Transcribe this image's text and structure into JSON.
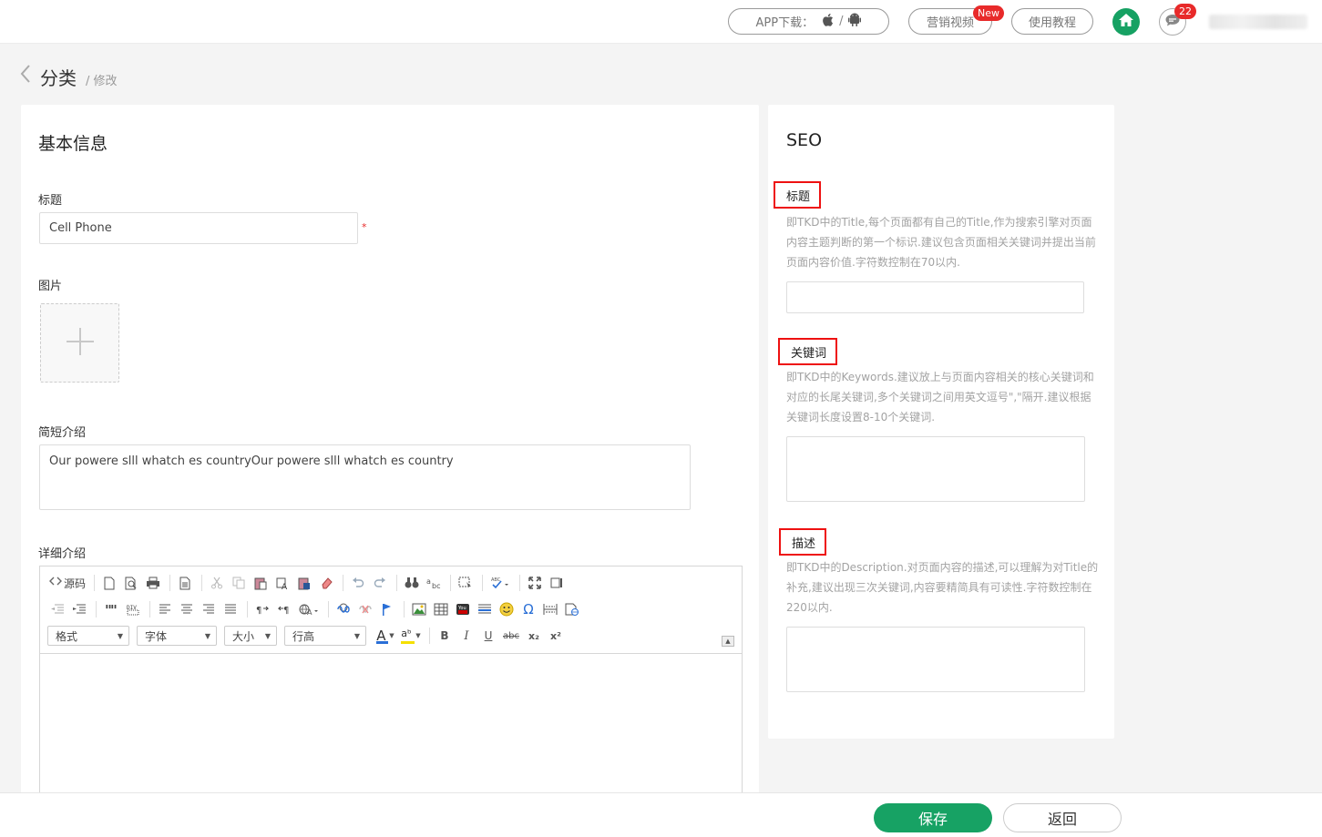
{
  "header": {
    "app_download_label": "APP下载：",
    "app_separator": "/",
    "marketing_video_label": "营销视频",
    "new_badge": "New",
    "tutorial_label": "使用教程",
    "message_count": "22"
  },
  "breadcrumb": {
    "title": "分类",
    "sub": "/ 修改"
  },
  "basic_info": {
    "section_title": "基本信息",
    "title_label": "标题",
    "title_value": "Cell Phone",
    "required_mark": "*",
    "image_label": "图片",
    "short_intro_label": "简短介绍",
    "short_intro_value": "Our powere slll whatch es countryOur powere slll whatch es country",
    "detail_label": "详细介绍"
  },
  "editor": {
    "source_label": "源码",
    "format_label": "格式",
    "font_label": "字体",
    "size_label": "大小",
    "line_height_label": "行高",
    "bold": "B",
    "italic": "I",
    "underline": "U",
    "strike": "abc",
    "subscript": "x₂",
    "superscript": "x²",
    "text_color": "A",
    "bg_color": "aᵇ",
    "omega": "Ω"
  },
  "seo": {
    "section_title": "SEO",
    "title_label": "标题",
    "title_help": "即TKD中的Title,每个页面都有自己的Title,作为搜索引擎对页面内容主题判断的第一个标识.建议包含页面相关关键词并提出当前页面内容价值.字符数控制在70以内.",
    "title_value": "",
    "keywords_label": "关键词",
    "keywords_help": "即TKD中的Keywords.建议放上与页面内容相关的核心关键词和对应的长尾关键词,多个关键词之间用英文逗号\",\"隔开.建议根据关键词长度设置8-10个关键词.",
    "keywords_value": "",
    "description_label": "描述",
    "description_help": "即TKD中的Description.对页面内容的描述,可以理解为对Title的补充,建议出现三次关键词,内容要精简具有可读性.字符数控制在220以内.",
    "description_value": ""
  },
  "footer": {
    "save_label": "保存",
    "back_label": "返回"
  },
  "colors": {
    "brand_green": "#17a264",
    "badge_red": "#e82a2a",
    "highlight_red": "#ee1111"
  }
}
